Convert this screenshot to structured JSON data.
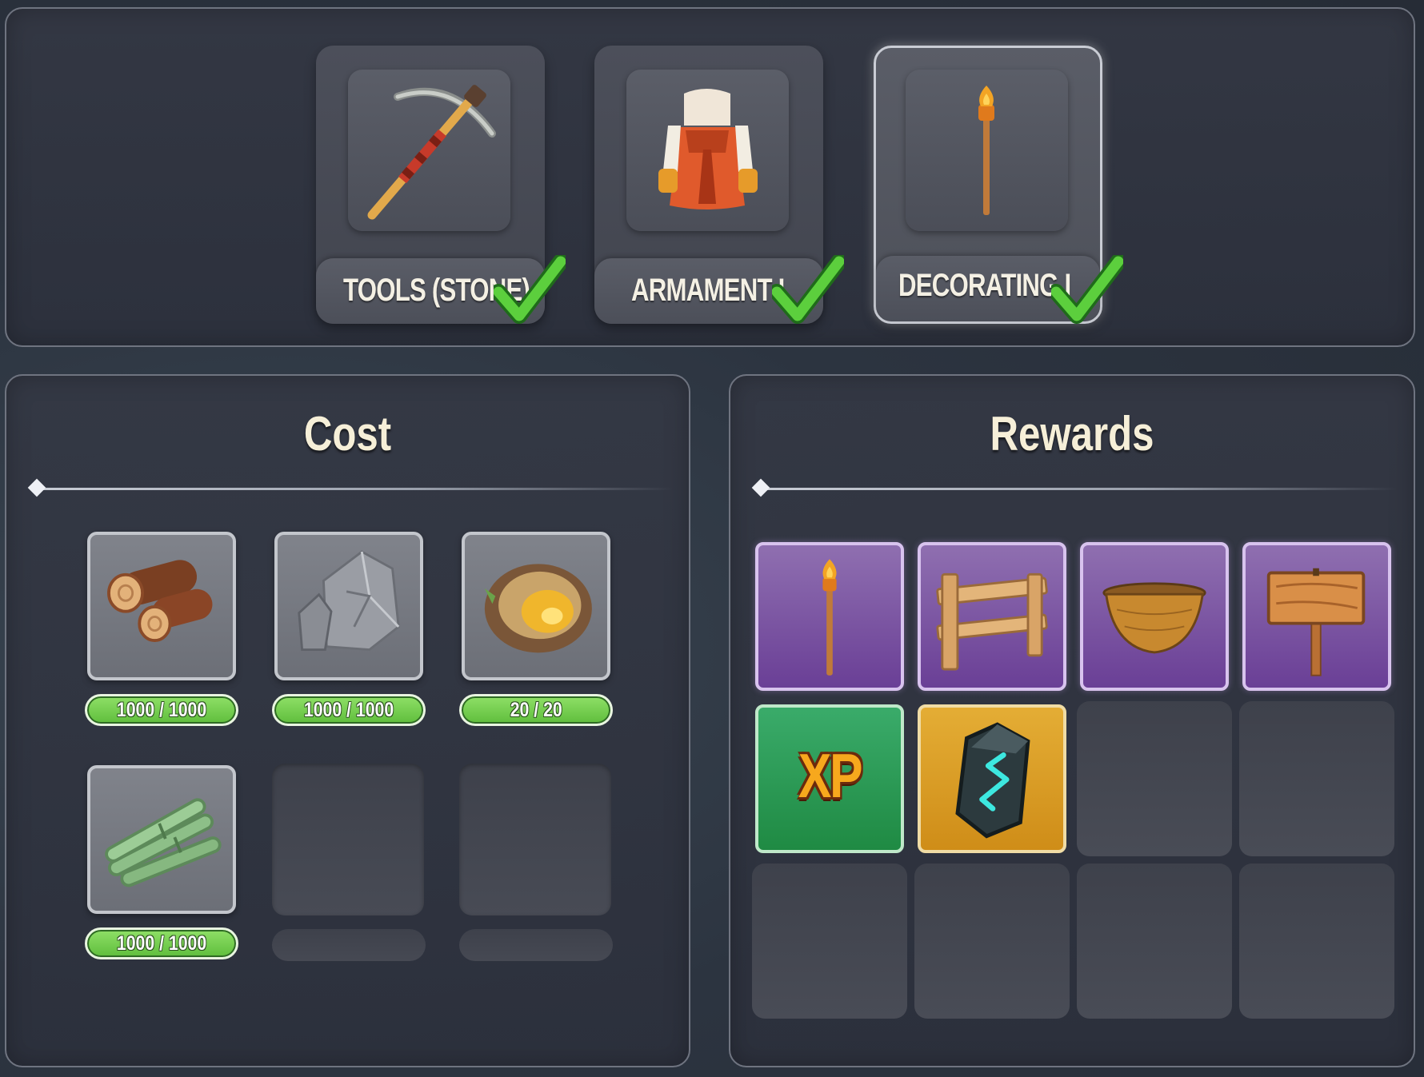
{
  "categories": [
    {
      "label": "TOOLS (STONE)",
      "icon": "pickaxe-icon",
      "completed": true,
      "selected": false
    },
    {
      "label": "ARMAMENT I",
      "icon": "armor-icon",
      "completed": true,
      "selected": false
    },
    {
      "label": "DECORATING I",
      "icon": "torch-icon",
      "completed": true,
      "selected": true
    }
  ],
  "cost": {
    "title": "Cost",
    "items": [
      {
        "icon": "wood-logs-icon",
        "amount": "1000 / 1000"
      },
      {
        "icon": "stone-icon",
        "amount": "1000 / 1000"
      },
      {
        "icon": "amber-ore-icon",
        "amount": "20 / 20"
      },
      {
        "icon": "bamboo-icon",
        "amount": "1000 / 1000"
      }
    ]
  },
  "rewards": {
    "title": "Rewards",
    "items": [
      {
        "icon": "torch-icon",
        "rarity": "purple"
      },
      {
        "icon": "fence-icon",
        "rarity": "purple"
      },
      {
        "icon": "basket-icon",
        "rarity": "purple"
      },
      {
        "icon": "signpost-icon",
        "rarity": "purple"
      },
      {
        "icon": "xp-icon",
        "label": "XP",
        "rarity": "green"
      },
      {
        "icon": "rune-stone-icon",
        "rarity": "gold"
      }
    ]
  },
  "colors": {
    "complete_green": "#5fbd3c",
    "epic_purple": "#6a3f96",
    "xp_green": "#1f8a43",
    "legendary_gold": "#cf8d18"
  }
}
